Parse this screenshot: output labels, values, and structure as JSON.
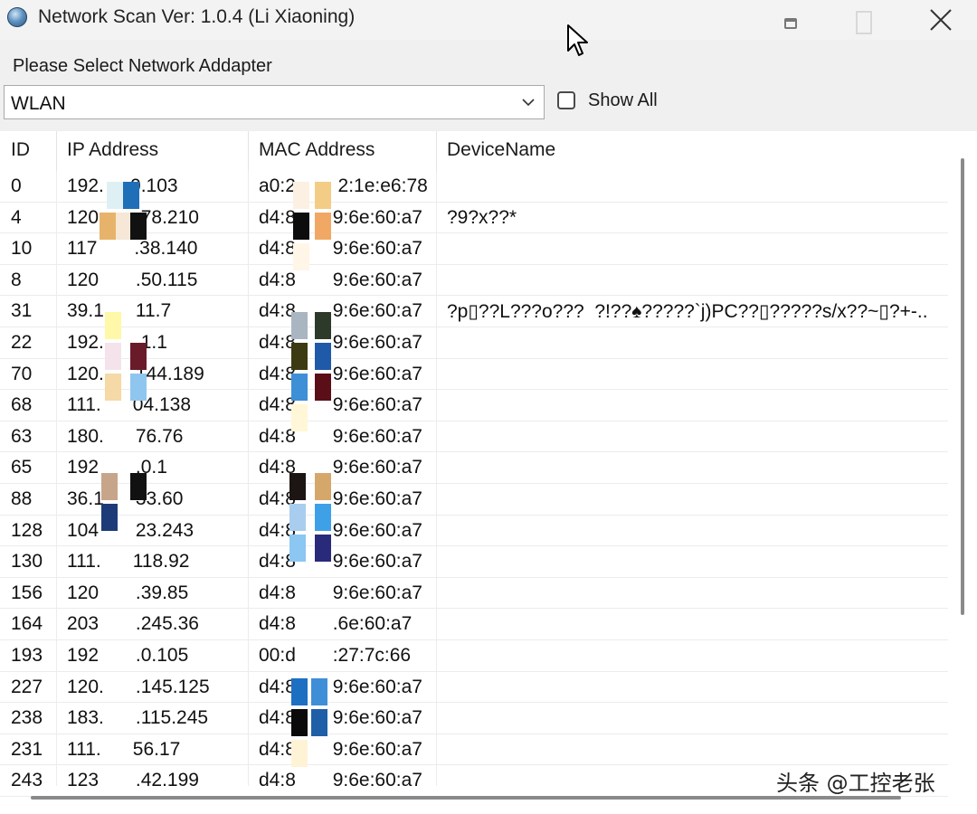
{
  "window": {
    "title": "Network Scan  Ver: 1.0.4  (Li Xiaoning)",
    "icon": "globe-icon"
  },
  "adapter": {
    "label": "Please Select Network Addapter",
    "selected": "WLAN",
    "show_all_label": "Show All",
    "show_all_checked": false
  },
  "table": {
    "columns": [
      "ID",
      "IP Address",
      "MAC Address",
      "DeviceName"
    ],
    "rows": [
      {
        "id": "0",
        "ip": "192.    .0.103",
        "mac": "a0:2        2:1e:e6:78",
        "device": ""
      },
      {
        "id": "4",
        "ip": "120       .78.210",
        "mac": "d4:8       9:6e:60:a7",
        "device": "?9?x??*"
      },
      {
        "id": "10",
        "ip": "117       .38.140",
        "mac": "d4:8       9:6e:60:a7",
        "device": ""
      },
      {
        "id": "8",
        "ip": "120       .50.115",
        "mac": "d4:8       9:6e:60:a7",
        "device": ""
      },
      {
        "id": "31",
        "ip": "39.1      11.7",
        "mac": "d4:8       9:6e:60:a7",
        "device": "?p▯??L???o???  ?!??♠?????`j)PC??▯?????s/x??~▯?+-.."
      },
      {
        "id": "22",
        "ip": "192.      .1.1",
        "mac": "d4:8       9:6e:60:a7",
        "device": ""
      },
      {
        "id": "70",
        "ip": "120.      144.189",
        "mac": "d4:8       9:6e:60:a7",
        "device": ""
      },
      {
        "id": "68",
        "ip": "111.      04.138",
        "mac": "d4:8       9:6e:60:a7",
        "device": ""
      },
      {
        "id": "63",
        "ip": "180.      76.76",
        "mac": "d4:8       9:6e:60:a7",
        "device": ""
      },
      {
        "id": "65",
        "ip": "192       .0.1",
        "mac": "d4:8       9:6e:60:a7",
        "device": ""
      },
      {
        "id": "88",
        "ip": "36.1      33.60",
        "mac": "d4:8       9:6e:60:a7",
        "device": ""
      },
      {
        "id": "128",
        "ip": "104       23.243",
        "mac": "d4:8       9:6e:60:a7",
        "device": ""
      },
      {
        "id": "130",
        "ip": "111.      118.92",
        "mac": "d4:8       9:6e:60:a7",
        "device": ""
      },
      {
        "id": "156",
        "ip": "120       .39.85",
        "mac": "d4:8       9:6e:60:a7",
        "device": ""
      },
      {
        "id": "164",
        "ip": "203       .245.36",
        "mac": "d4:8       .6e:60:a7",
        "device": ""
      },
      {
        "id": "193",
        "ip": "192       .0.105",
        "mac": "00:d       :27:7c:66",
        "device": ""
      },
      {
        "id": "227",
        "ip": "120.      .145.125",
        "mac": "d4:8       9:6e:60:a7",
        "device": ""
      },
      {
        "id": "238",
        "ip": "183.      .115.245",
        "mac": "d4:8       9:6e:60:a7",
        "device": ""
      },
      {
        "id": "231",
        "ip": "111.      56.17",
        "mac": "d4:8       9:6e:60:a7",
        "device": ""
      },
      {
        "id": "243",
        "ip": "123       .42.199",
        "mac": "d4:8       9:6e:60:a7",
        "device": ""
      }
    ]
  },
  "watermark": "头条 @工控老张",
  "colors": {
    "window_bg": "#f0f0f0",
    "list_bg": "#ffffff",
    "grid_line": "#ececec",
    "scrollbar": "#8a8a8a"
  }
}
